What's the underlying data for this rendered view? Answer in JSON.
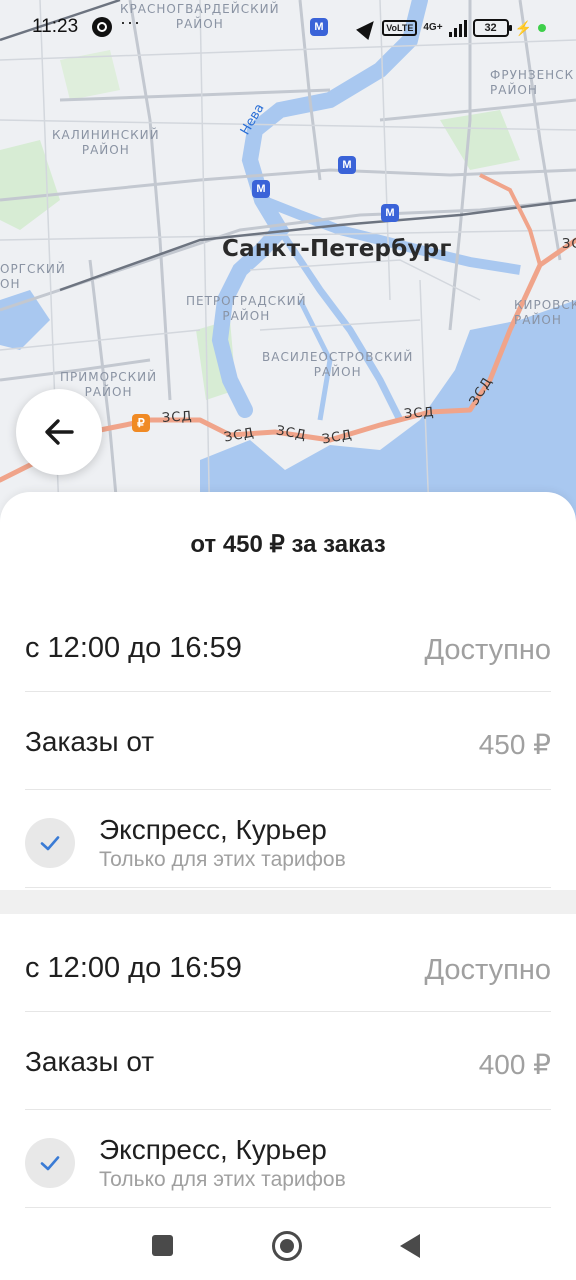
{
  "status_bar": {
    "time": "11:23",
    "more": "···",
    "volte": "VoLTE",
    "network": "4G+",
    "battery": "32"
  },
  "map": {
    "city": "Санкт-Петербург",
    "river": "Нева",
    "districts": {
      "krasnogvardeisky": "КРАСНОГВАРДЕЙСКИЙ\nРАЙОН",
      "kalininsky": "КАЛИНИНСКИЙ\nРАЙОН",
      "frunzensky": "ФРУНЗЕНСК\nРАЙОН",
      "petrogradsky": "ПЕТРОГРАДСКИЙ\nРАЙОН",
      "vasileostrovsky": "ВАСИЛЕОСТРОВСКИЙ\nРАЙОН",
      "primorsky": "ПРИМОРСКИЙ\nРАЙОН",
      "kirovsky": "КИРОВСК\nРАЙОН",
      "vyborgsky": "ОРГСКИЙ\nОН"
    },
    "road_label": "ЗСД",
    "road_label_short": "ЗС",
    "paid_marker": "₽",
    "metro_marker": "М",
    "colors": {
      "route": "#f0a48a",
      "water": "#a9c8f0",
      "metro": "#3a63d8"
    }
  },
  "sheet": {
    "title": "от 450 ₽ за заказ",
    "slots": [
      {
        "time_label": "с 12:00 до 16:59",
        "time_status": "Доступно",
        "orders_label": "Заказы от",
        "orders_value": "450 ₽",
        "tariff_name": "Экспресс, Курьер",
        "tariff_note": "Только для этих тарифов"
      },
      {
        "time_label": "с 12:00 до 16:59",
        "time_status": "Доступно",
        "orders_label": "Заказы от",
        "orders_value": "400 ₽",
        "tariff_name": "Экспресс, Курьер",
        "tariff_note": "Только для этих тарифов"
      }
    ]
  },
  "icons": {
    "back": "arrow-left-icon",
    "check": "checkmark-icon",
    "nav_recent": "square-icon",
    "nav_home": "circle-icon",
    "nav_back": "triangle-back-icon"
  },
  "accent_color": "#3a7bd5"
}
